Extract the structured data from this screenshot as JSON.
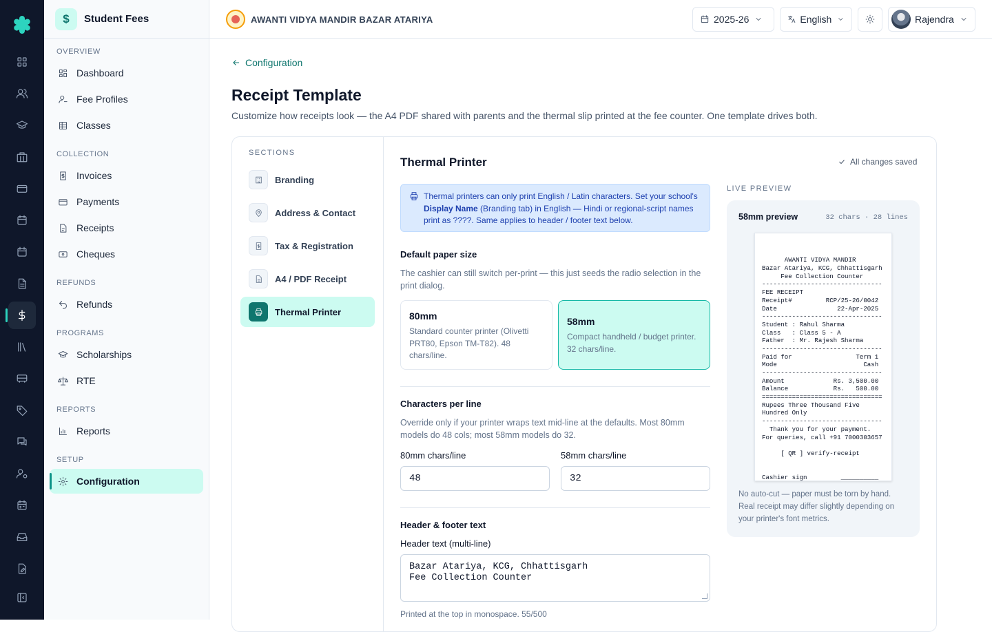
{
  "app": {
    "title": "Student Fees",
    "brand_symbol": "$"
  },
  "rail": {
    "icons": [
      "apps-icon",
      "users-icon",
      "graduation-cap-icon",
      "building-icon",
      "card-icon",
      "calendar-icon",
      "calendar-check-icon",
      "document-icon",
      "dollar-icon",
      "library-icon",
      "bus-icon",
      "tag-icon",
      "chat-icon",
      "user-settings-icon",
      "schedule-icon",
      "inbox-icon",
      "file-edit-icon",
      "collapse-sidebar-icon"
    ],
    "active": "dollar-icon"
  },
  "sidebar": {
    "sections": {
      "overview": "OVERVIEW",
      "collection": "COLLECTION",
      "refunds": "REFUNDS",
      "programs": "PROGRAMS",
      "reports": "REPORTS",
      "setup": "SETUP"
    },
    "items": {
      "dashboard": "Dashboard",
      "fee_profiles": "Fee Profiles",
      "classes": "Classes",
      "invoices": "Invoices",
      "payments": "Payments",
      "receipts": "Receipts",
      "cheques": "Cheques",
      "refunds": "Refunds",
      "scholarships": "Scholarships",
      "rte": "RTE",
      "reports": "Reports",
      "configuration": "Configuration"
    }
  },
  "topbar": {
    "school_name": "AWANTI VIDYA MANDIR BAZAR ATARIYA",
    "year": "2025-26",
    "language": "English",
    "user": "Rajendra"
  },
  "page": {
    "back_label": "Configuration",
    "title": "Receipt Template",
    "description": "Customize how receipts look — the A4 PDF shared with parents and the thermal slip printed at the fee counter. One template drives both."
  },
  "sections_nav": {
    "label": "SECTIONS",
    "items": {
      "branding": "Branding",
      "address": "Address & Contact",
      "tax": "Tax & Registration",
      "a4": "A4 / PDF Receipt",
      "thermal": "Thermal Printer"
    },
    "active": "thermal"
  },
  "thermal": {
    "heading": "Thermal Printer",
    "saved_status": "All changes saved",
    "info": {
      "part1": "Thermal printers can only print English / Latin characters. Set your school's ",
      "bold": "Display Name",
      "part2": " (Branding tab) in English — Hindi or regional-script names print as ????. Same applies to header / footer text below."
    },
    "paper": {
      "label": "Default paper size",
      "help": "The cashier can still switch per-print — this just seeds the radio selection in the print dialog.",
      "options": [
        {
          "title": "80mm",
          "desc": "Standard counter printer (Olivetti PRT80, Epson TM-T82). 48 chars/line."
        },
        {
          "title": "58mm",
          "desc": "Compact handheld / budget printer. 32 chars/line."
        }
      ],
      "selected": "58mm"
    },
    "chars": {
      "label": "Characters per line",
      "help": "Override only if your printer wraps text mid-line at the defaults. Most 80mm models do 48 cols; most 58mm models do 32.",
      "label_80": "80mm chars/line",
      "value_80": "48",
      "label_58": "58mm chars/line",
      "value_58": "32"
    },
    "header_footer": {
      "label": "Header & footer text",
      "header_label": "Header text (multi-line)",
      "header_value": "Bazar Atariya, KCG, Chhattisgarh\nFee Collection Counter",
      "header_hint": "Printed at the top in monospace. 55/500"
    }
  },
  "preview": {
    "label": "LIVE PREVIEW",
    "title": "58mm preview",
    "meta": "32 chars · 28 lines",
    "lines": [
      "      AWANTI VIDYA MANDIR",
      "Bazar Atariya, KCG, Chhattisgarh",
      "     Fee Collection Counter",
      "--------------------------------",
      "FEE RECEIPT",
      "Receipt#         RCP/25-26/0042",
      "Date                22-Apr-2025",
      "--------------------------------",
      "Student : Rahul Sharma",
      "Class   : Class 5 - A",
      "Father  : Mr. Rajesh Sharma",
      "--------------------------------",
      "Paid for                 Term 1",
      "Mode                       Cash",
      "--------------------------------",
      "Amount             Rs. 3,500.00",
      "Balance            Rs.   500.00",
      "================================",
      "Rupees Three Thousand Five",
      "Hundred Only",
      "--------------------------------",
      "  Thank you for your payment.",
      "For queries, call +91 7000303657",
      "",
      "     [ QR ] verify-receipt",
      "",
      "",
      "Cashier sign         __________"
    ],
    "cut_symbol": "✂",
    "note": "No auto-cut — paper must be torn by hand. Real receipt may differ slightly depending on your printer's font metrics."
  }
}
